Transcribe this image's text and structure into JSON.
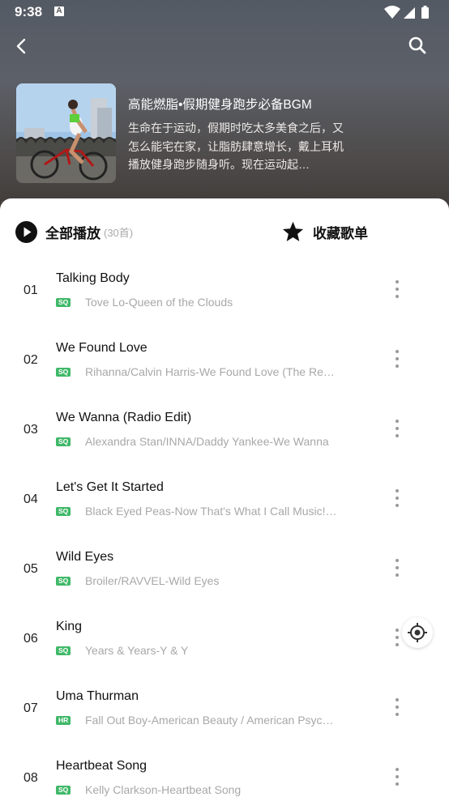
{
  "status_bar": {
    "time": "9:38",
    "notification_letter": "A"
  },
  "playlist": {
    "title": "高能燃脂•假期健身跑步必备BGM",
    "description": "生命在于运动，假期时吃太多美食之后，又怎么能宅在家，让脂肪肆意增长，戴上耳机播放健身跑步随身听。现在运动起…"
  },
  "actions": {
    "play_all_label": "全部播放",
    "play_all_count": "(30首)",
    "collect_label": "收藏歌单"
  },
  "tracks": [
    {
      "num": "01",
      "title": "Talking Body",
      "quality": "SQ",
      "artist": "Tove Lo-Queen of the Clouds"
    },
    {
      "num": "02",
      "title": "We Found Love",
      "quality": "SQ",
      "artist": "Rihanna/Calvin Harris-We Found Love (The Re…"
    },
    {
      "num": "03",
      "title": "We Wanna (Radio Edit)",
      "quality": "SQ",
      "artist": "Alexandra Stan/INNA/Daddy Yankee-We Wanna"
    },
    {
      "num": "04",
      "title": "Let's Get It Started",
      "quality": "SQ",
      "artist": "Black Eyed Peas-Now That's What I Call Music!…"
    },
    {
      "num": "05",
      "title": "Wild Eyes",
      "quality": "SQ",
      "artist": "Broiler/RAVVEL-Wild Eyes"
    },
    {
      "num": "06",
      "title": "King",
      "quality": "SQ",
      "artist": "Years & Years-Y & Y"
    },
    {
      "num": "07",
      "title": "Uma Thurman",
      "quality": "HR",
      "artist": "Fall Out Boy-American Beauty / American Psyc…"
    },
    {
      "num": "08",
      "title": "Heartbeat Song",
      "quality": "SQ",
      "artist": "Kelly Clarkson-Heartbeat Song"
    }
  ],
  "colors": {
    "quality_badge": "#3fb868",
    "header_top": "#545a64",
    "header_bottom": "#3c3633"
  },
  "icons": {
    "back": "chevron-left-icon",
    "search": "search-icon",
    "play_all": "play-circle-icon",
    "collect": "star-icon",
    "more": "more-vertical-icon",
    "locate": "locate-icon"
  }
}
